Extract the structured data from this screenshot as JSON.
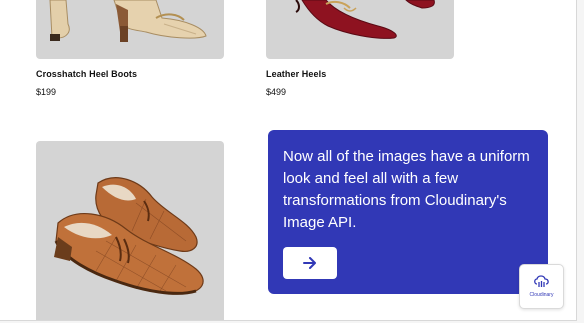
{
  "products": [
    {
      "name": "Crosshatch Heel Boots",
      "price": "$199",
      "image": "beige-heel-boots"
    },
    {
      "name": "Leather Heels",
      "price": "$499",
      "image": "red-leather-heels"
    },
    {
      "name": "",
      "price": "",
      "image": "brown-woven-loafers"
    }
  ],
  "promo": {
    "text": "Now all of the images have a uniform look and feel all with a few transformations from Cloudinary's Image API.",
    "button_icon": "arrow-right-icon",
    "background": "#3138b6"
  },
  "badge": {
    "label": "Cloudinary",
    "icon": "cloudinary-cloud-icon"
  }
}
